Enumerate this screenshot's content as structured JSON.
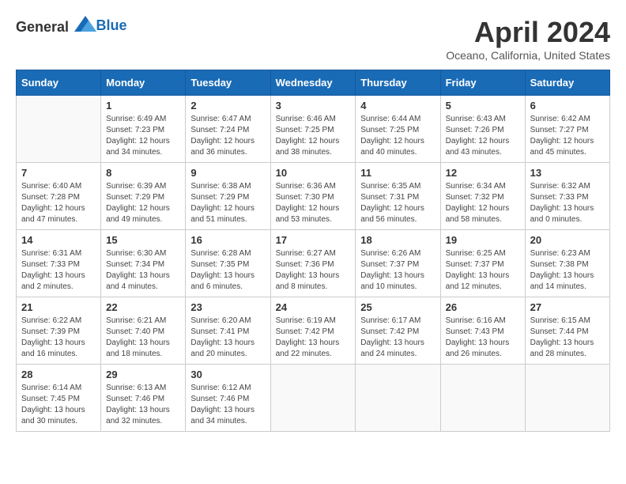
{
  "header": {
    "logo_general": "General",
    "logo_blue": "Blue",
    "month_title": "April 2024",
    "location": "Oceano, California, United States"
  },
  "days_of_week": [
    "Sunday",
    "Monday",
    "Tuesday",
    "Wednesday",
    "Thursday",
    "Friday",
    "Saturday"
  ],
  "weeks": [
    [
      {
        "day": "",
        "sunrise": "",
        "sunset": "",
        "daylight": ""
      },
      {
        "day": "1",
        "sunrise": "Sunrise: 6:49 AM",
        "sunset": "Sunset: 7:23 PM",
        "daylight": "Daylight: 12 hours and 34 minutes."
      },
      {
        "day": "2",
        "sunrise": "Sunrise: 6:47 AM",
        "sunset": "Sunset: 7:24 PM",
        "daylight": "Daylight: 12 hours and 36 minutes."
      },
      {
        "day": "3",
        "sunrise": "Sunrise: 6:46 AM",
        "sunset": "Sunset: 7:25 PM",
        "daylight": "Daylight: 12 hours and 38 minutes."
      },
      {
        "day": "4",
        "sunrise": "Sunrise: 6:44 AM",
        "sunset": "Sunset: 7:25 PM",
        "daylight": "Daylight: 12 hours and 40 minutes."
      },
      {
        "day": "5",
        "sunrise": "Sunrise: 6:43 AM",
        "sunset": "Sunset: 7:26 PM",
        "daylight": "Daylight: 12 hours and 43 minutes."
      },
      {
        "day": "6",
        "sunrise": "Sunrise: 6:42 AM",
        "sunset": "Sunset: 7:27 PM",
        "daylight": "Daylight: 12 hours and 45 minutes."
      }
    ],
    [
      {
        "day": "7",
        "sunrise": "Sunrise: 6:40 AM",
        "sunset": "Sunset: 7:28 PM",
        "daylight": "Daylight: 12 hours and 47 minutes."
      },
      {
        "day": "8",
        "sunrise": "Sunrise: 6:39 AM",
        "sunset": "Sunset: 7:29 PM",
        "daylight": "Daylight: 12 hours and 49 minutes."
      },
      {
        "day": "9",
        "sunrise": "Sunrise: 6:38 AM",
        "sunset": "Sunset: 7:29 PM",
        "daylight": "Daylight: 12 hours and 51 minutes."
      },
      {
        "day": "10",
        "sunrise": "Sunrise: 6:36 AM",
        "sunset": "Sunset: 7:30 PM",
        "daylight": "Daylight: 12 hours and 53 minutes."
      },
      {
        "day": "11",
        "sunrise": "Sunrise: 6:35 AM",
        "sunset": "Sunset: 7:31 PM",
        "daylight": "Daylight: 12 hours and 56 minutes."
      },
      {
        "day": "12",
        "sunrise": "Sunrise: 6:34 AM",
        "sunset": "Sunset: 7:32 PM",
        "daylight": "Daylight: 12 hours and 58 minutes."
      },
      {
        "day": "13",
        "sunrise": "Sunrise: 6:32 AM",
        "sunset": "Sunset: 7:33 PM",
        "daylight": "Daylight: 13 hours and 0 minutes."
      }
    ],
    [
      {
        "day": "14",
        "sunrise": "Sunrise: 6:31 AM",
        "sunset": "Sunset: 7:33 PM",
        "daylight": "Daylight: 13 hours and 2 minutes."
      },
      {
        "day": "15",
        "sunrise": "Sunrise: 6:30 AM",
        "sunset": "Sunset: 7:34 PM",
        "daylight": "Daylight: 13 hours and 4 minutes."
      },
      {
        "day": "16",
        "sunrise": "Sunrise: 6:28 AM",
        "sunset": "Sunset: 7:35 PM",
        "daylight": "Daylight: 13 hours and 6 minutes."
      },
      {
        "day": "17",
        "sunrise": "Sunrise: 6:27 AM",
        "sunset": "Sunset: 7:36 PM",
        "daylight": "Daylight: 13 hours and 8 minutes."
      },
      {
        "day": "18",
        "sunrise": "Sunrise: 6:26 AM",
        "sunset": "Sunset: 7:37 PM",
        "daylight": "Daylight: 13 hours and 10 minutes."
      },
      {
        "day": "19",
        "sunrise": "Sunrise: 6:25 AM",
        "sunset": "Sunset: 7:37 PM",
        "daylight": "Daylight: 13 hours and 12 minutes."
      },
      {
        "day": "20",
        "sunrise": "Sunrise: 6:23 AM",
        "sunset": "Sunset: 7:38 PM",
        "daylight": "Daylight: 13 hours and 14 minutes."
      }
    ],
    [
      {
        "day": "21",
        "sunrise": "Sunrise: 6:22 AM",
        "sunset": "Sunset: 7:39 PM",
        "daylight": "Daylight: 13 hours and 16 minutes."
      },
      {
        "day": "22",
        "sunrise": "Sunrise: 6:21 AM",
        "sunset": "Sunset: 7:40 PM",
        "daylight": "Daylight: 13 hours and 18 minutes."
      },
      {
        "day": "23",
        "sunrise": "Sunrise: 6:20 AM",
        "sunset": "Sunset: 7:41 PM",
        "daylight": "Daylight: 13 hours and 20 minutes."
      },
      {
        "day": "24",
        "sunrise": "Sunrise: 6:19 AM",
        "sunset": "Sunset: 7:42 PM",
        "daylight": "Daylight: 13 hours and 22 minutes."
      },
      {
        "day": "25",
        "sunrise": "Sunrise: 6:17 AM",
        "sunset": "Sunset: 7:42 PM",
        "daylight": "Daylight: 13 hours and 24 minutes."
      },
      {
        "day": "26",
        "sunrise": "Sunrise: 6:16 AM",
        "sunset": "Sunset: 7:43 PM",
        "daylight": "Daylight: 13 hours and 26 minutes."
      },
      {
        "day": "27",
        "sunrise": "Sunrise: 6:15 AM",
        "sunset": "Sunset: 7:44 PM",
        "daylight": "Daylight: 13 hours and 28 minutes."
      }
    ],
    [
      {
        "day": "28",
        "sunrise": "Sunrise: 6:14 AM",
        "sunset": "Sunset: 7:45 PM",
        "daylight": "Daylight: 13 hours and 30 minutes."
      },
      {
        "day": "29",
        "sunrise": "Sunrise: 6:13 AM",
        "sunset": "Sunset: 7:46 PM",
        "daylight": "Daylight: 13 hours and 32 minutes."
      },
      {
        "day": "30",
        "sunrise": "Sunrise: 6:12 AM",
        "sunset": "Sunset: 7:46 PM",
        "daylight": "Daylight: 13 hours and 34 minutes."
      },
      {
        "day": "",
        "sunrise": "",
        "sunset": "",
        "daylight": ""
      },
      {
        "day": "",
        "sunrise": "",
        "sunset": "",
        "daylight": ""
      },
      {
        "day": "",
        "sunrise": "",
        "sunset": "",
        "daylight": ""
      },
      {
        "day": "",
        "sunrise": "",
        "sunset": "",
        "daylight": ""
      }
    ]
  ]
}
